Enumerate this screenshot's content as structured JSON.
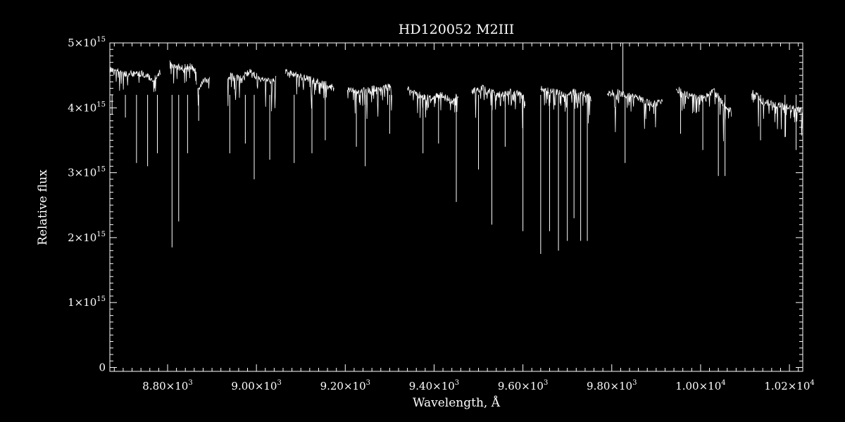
{
  "chart_data": {
    "type": "line",
    "title": "HD120052   M2III",
    "xlabel": "Wavelength, Å",
    "ylabel": "Relative flux",
    "xlim": [
      8670,
      10230
    ],
    "ylim": [
      -60000000000000.0,
      5000000000000000.0
    ],
    "grid": false,
    "colors": {
      "background": "#000000",
      "line": "#ffffff",
      "axes": "#ffffff"
    },
    "x_ticks": [
      {
        "value": 8800,
        "mantissa": "8.80",
        "exp": "3"
      },
      {
        "value": 9000,
        "mantissa": "9.00",
        "exp": "3"
      },
      {
        "value": 9200,
        "mantissa": "9.20",
        "exp": "3"
      },
      {
        "value": 9400,
        "mantissa": "9.40",
        "exp": "3"
      },
      {
        "value": 9600,
        "mantissa": "9.60",
        "exp": "3"
      },
      {
        "value": 9800,
        "mantissa": "9.80",
        "exp": "3"
      },
      {
        "value": 10000,
        "mantissa": "1.00",
        "exp": "4"
      },
      {
        "value": 10200,
        "mantissa": "1.02",
        "exp": "4"
      }
    ],
    "y_ticks": [
      {
        "value": 0,
        "mantissa": "0",
        "exp": ""
      },
      {
        "value": 1000000000000000.0,
        "mantissa": "1",
        "exp": "15"
      },
      {
        "value": 2000000000000000.0,
        "mantissa": "2",
        "exp": "15"
      },
      {
        "value": 3000000000000000.0,
        "mantissa": "3",
        "exp": "15"
      },
      {
        "value": 4000000000000000.0,
        "mantissa": "4",
        "exp": "15"
      },
      {
        "value": 5000000000000000.0,
        "mantissa": "5",
        "exp": "15"
      }
    ],
    "series": [
      {
        "segments": [
          {
            "x": [
              8670,
              8690,
              8710,
              8730,
              8750,
              8770,
              8785
            ],
            "y": [
              4600000000000000.0,
              4550000000000000.0,
              4500000000000000.0,
              4550000000000000.0,
              4500000000000000.0,
              4450000000000000.0,
              4550000000000000.0
            ]
          },
          {
            "x": [
              8805,
              8830,
              8850,
              8865
            ],
            "y": [
              4700000000000000.0,
              4600000000000000.0,
              4650000000000000.0,
              4550000000000000.0
            ]
          },
          {
            "x": [
              8868,
              8880,
              8895
            ],
            "y": [
              4300000000000000.0,
              4400000000000000.0,
              4450000000000000.0
            ]
          },
          {
            "x": [
              8935,
              8960,
              8985,
              9010,
              9035,
              9045
            ],
            "y": [
              4500000000000000.0,
              4450000000000000.0,
              4550000000000000.0,
              4450000000000000.0,
              4400000000000000.0,
              4450000000000000.0
            ]
          },
          {
            "x": [
              9065,
              9090,
              9115,
              9140,
              9160,
              9175
            ],
            "y": [
              4550000000000000.0,
              4500000000000000.0,
              4450000000000000.0,
              4400000000000000.0,
              4350000000000000.0,
              4300000000000000.0
            ]
          },
          {
            "x": [
              9205,
              9235,
              9265,
              9290,
              9305
            ],
            "y": [
              4300000000000000.0,
              4250000000000000.0,
              4300000000000000.0,
              4300000000000000.0,
              4350000000000000.0
            ]
          },
          {
            "x": [
              9340,
              9365,
              9390,
              9415,
              9440,
              9455
            ],
            "y": [
              4300000000000000.0,
              4200000000000000.0,
              4150000000000000.0,
              4200000000000000.0,
              4100000000000000.0,
              4200000000000000.0
            ]
          },
          {
            "x": [
              9485,
              9510,
              9540,
              9570,
              9595,
              9605
            ],
            "y": [
              4250000000000000.0,
              4300000000000000.0,
              4200000000000000.0,
              4250000000000000.0,
              4200000000000000.0,
              4150000000000000.0
            ]
          },
          {
            "x": [
              9640,
              9665,
              9695,
              9720,
              9745,
              9755
            ],
            "y": [
              4300000000000000.0,
              4250000000000000.0,
              4200000000000000.0,
              4250000000000000.0,
              4200000000000000.0,
              4150000000000000.0
            ]
          },
          {
            "x": [
              9790,
              9810,
              9830,
              9860,
              9890,
              9915
            ],
            "y": [
              4200000000000000.0,
              4250000000000000.0,
              4200000000000000.0,
              4150000000000000.0,
              4050000000000000.0,
              4100000000000000.0
            ]
          },
          {
            "x": [
              9945,
              9970,
              10000,
              10030,
              10060,
              10070
            ],
            "y": [
              4300000000000000.0,
              4200000000000000.0,
              4150000000000000.0,
              4250000000000000.0,
              4000000000000000.0,
              3950000000000000.0
            ]
          },
          {
            "x": [
              10115,
              10140,
              10170,
              10200,
              10230
            ],
            "y": [
              4250000000000000.0,
              4100000000000000.0,
              4050000000000000.0,
              4000000000000000.0,
              3950000000000000.0
            ]
          }
        ]
      }
    ],
    "absorption_lines": [
      {
        "x": 8675,
        "y": 3900000000000000.0
      },
      {
        "x": 8705,
        "y": 3850000000000000.0
      },
      {
        "x": 8730,
        "y": 3150000000000000.0
      },
      {
        "x": 8755,
        "y": 3100000000000000.0
      },
      {
        "x": 8777,
        "y": 3300000000000000.0
      },
      {
        "x": 8810,
        "y": 1850000000000000.0
      },
      {
        "x": 8825,
        "y": 2250000000000000.0
      },
      {
        "x": 8845,
        "y": 3300000000000000.0
      },
      {
        "x": 8870,
        "y": 3800000000000000.0
      },
      {
        "x": 8940,
        "y": 3300000000000000.0
      },
      {
        "x": 8975,
        "y": 3450000000000000.0
      },
      {
        "x": 8995,
        "y": 2900000000000000.0
      },
      {
        "x": 9030,
        "y": 3200000000000000.0
      },
      {
        "x": 9085,
        "y": 3150000000000000.0
      },
      {
        "x": 9125,
        "y": 3300000000000000.0
      },
      {
        "x": 9155,
        "y": 3500000000000000.0
      },
      {
        "x": 9225,
        "y": 3400000000000000.0
      },
      {
        "x": 9245,
        "y": 3100000000000000.0
      },
      {
        "x": 9300,
        "y": 3600000000000000.0
      },
      {
        "x": 9375,
        "y": 3300000000000000.0
      },
      {
        "x": 9410,
        "y": 3450000000000000.0
      },
      {
        "x": 9450,
        "y": 2550000000000000.0
      },
      {
        "x": 9500,
        "y": 3050000000000000.0
      },
      {
        "x": 9530,
        "y": 2200000000000000.0
      },
      {
        "x": 9560,
        "y": 3400000000000000.0
      },
      {
        "x": 9600,
        "y": 2100000000000000.0
      },
      {
        "x": 9640,
        "y": 1750000000000000.0
      },
      {
        "x": 9660,
        "y": 2100000000000000.0
      },
      {
        "x": 9680,
        "y": 1800000000000000.0
      },
      {
        "x": 9700,
        "y": 1950000000000000.0
      },
      {
        "x": 9715,
        "y": 2300000000000000.0
      },
      {
        "x": 9730,
        "y": 1950000000000000.0
      },
      {
        "x": 9745,
        "y": 1950000000000000.0
      },
      {
        "x": 9830,
        "y": 3150000000000000.0
      },
      {
        "x": 9955,
        "y": 3600000000000000.0
      },
      {
        "x": 10005,
        "y": 3350000000000000.0
      },
      {
        "x": 10040,
        "y": 2950000000000000.0
      },
      {
        "x": 10055,
        "y": 2950000000000000.0
      },
      {
        "x": 10135,
        "y": 3500000000000000.0
      },
      {
        "x": 10190,
        "y": 3550000000000000.0
      },
      {
        "x": 10215,
        "y": 3350000000000000.0
      }
    ],
    "emission_lines": [
      {
        "x": 9825,
        "y": 5000000000000000.0
      }
    ]
  }
}
